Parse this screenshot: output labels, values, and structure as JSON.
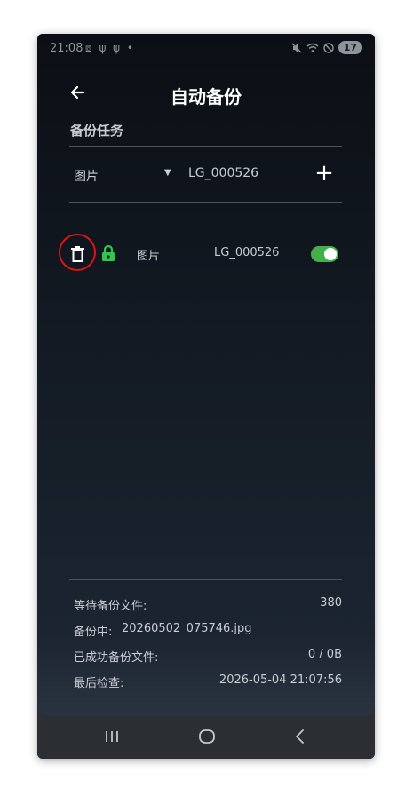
{
  "statusbar": {
    "time": "21:08",
    "notification_icons": "⧈ ψ ψ •",
    "battery_level": "17"
  },
  "header": {
    "title": "自动备份"
  },
  "section": {
    "title": "备份任务"
  },
  "add_form": {
    "type_value": "图片",
    "device": "LG_000526",
    "add_label": "+"
  },
  "tasks": [
    {
      "type": "图片",
      "device": "LG_000526",
      "locked": true,
      "enabled": true
    }
  ],
  "stats": {
    "pending_label": "等待备份文件:",
    "pending_value": "380",
    "current_label": "备份中:",
    "current_value": "20260502_075746.jpg",
    "success_label": "已成功备份文件:",
    "success_value": "0 /  0B",
    "last_check_label": "最后检查:",
    "last_check_value": "2026-05-04 21:07:56"
  },
  "colors": {
    "accent_green": "#43b04a",
    "highlight_red": "#e01313",
    "background": "#131a23"
  },
  "icons": [
    "back-arrow-icon",
    "dropdown-caret-icon",
    "add-icon",
    "trash-icon",
    "lock-icon",
    "toggle-switch",
    "recents-icon",
    "home-icon",
    "back-nav-icon"
  ]
}
